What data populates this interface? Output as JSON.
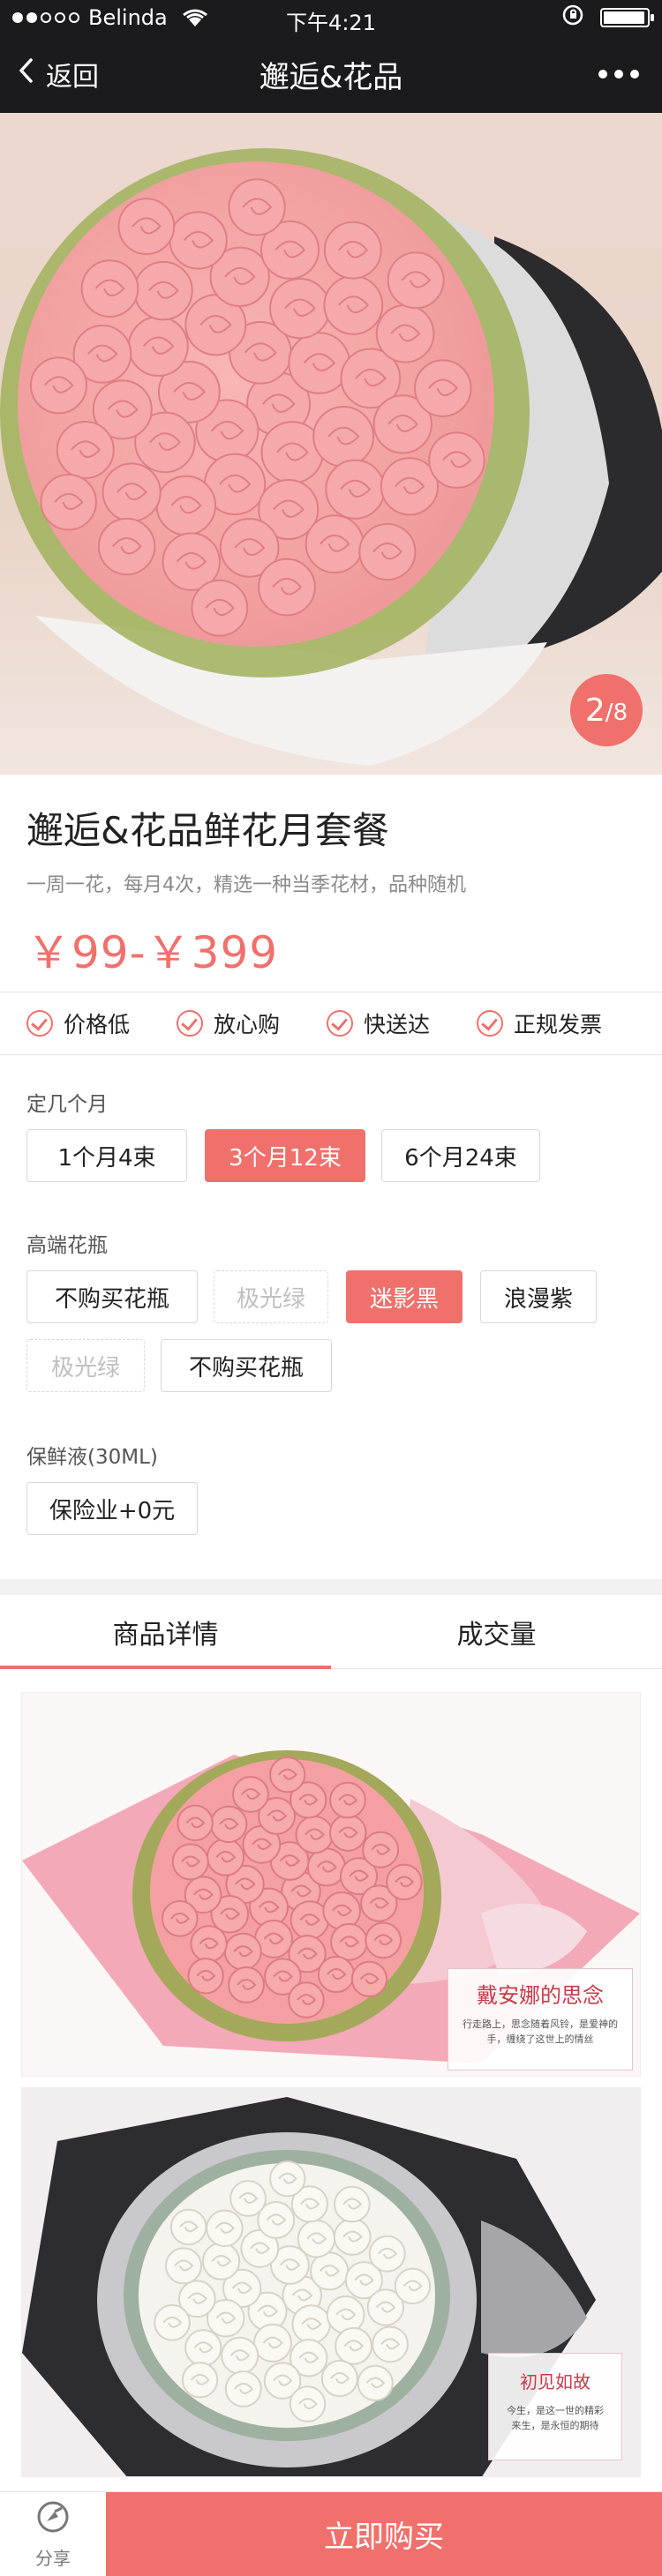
{
  "status_bar": {
    "carrier": "Belinda",
    "time": "下午4:21",
    "battery_level": 0.95,
    "icons": [
      "signal-dots-icon",
      "wifi-icon",
      "orientation-lock-icon",
      "battery-icon"
    ]
  },
  "nav": {
    "back_label": "返回",
    "title": "邂逅&花品",
    "icons": [
      "chevron-left-icon",
      "more-dots-icon"
    ]
  },
  "hero": {
    "page_current": "2",
    "page_total": "8"
  },
  "product": {
    "title": "邂逅&花品鲜花月套餐",
    "subtitle": "一周一花，每月4次，精选一种当季花材，品种随机",
    "price": "￥99-￥399"
  },
  "guarantees": [
    "价格低",
    "放心购",
    "快送达",
    "正规发票"
  ],
  "options": {
    "months": {
      "label": "定几个月",
      "items": [
        "1个月4束",
        "3个月12束",
        "6个月24束"
      ],
      "selected": "3个月12束"
    },
    "vase": {
      "label": "高端花瓶",
      "items": [
        "不购买花瓶",
        "极光绿",
        "迷影黑",
        "浪漫紫",
        "极光绿",
        "不购买花瓶"
      ],
      "selected": "迷影黑",
      "disabled": [
        "极光绿"
      ]
    },
    "preservative": {
      "label": "保鲜液(30ML)",
      "items": [
        "保险业+0元"
      ]
    }
  },
  "tabs": {
    "items": [
      "商品详情",
      "成交量"
    ],
    "active": "商品详情"
  },
  "detail_images": [
    {
      "caption_title": "戴安娜的思念",
      "caption_lines": [
        "行走路上，思念随着风铃，是爱神的",
        "手，缠绕了这世上的情丝"
      ]
    },
    {
      "caption_title": "初见如故",
      "caption_lines": [
        "今生，是这一世的精彩",
        "来生，是永恒的期待"
      ]
    }
  ],
  "bottom_bar": {
    "share_label": "分享",
    "buy_label": "立即购买"
  },
  "colors": {
    "accent": "#f0706c",
    "nav_bg": "#1b1b1d",
    "separator": "#f2f2f2"
  }
}
